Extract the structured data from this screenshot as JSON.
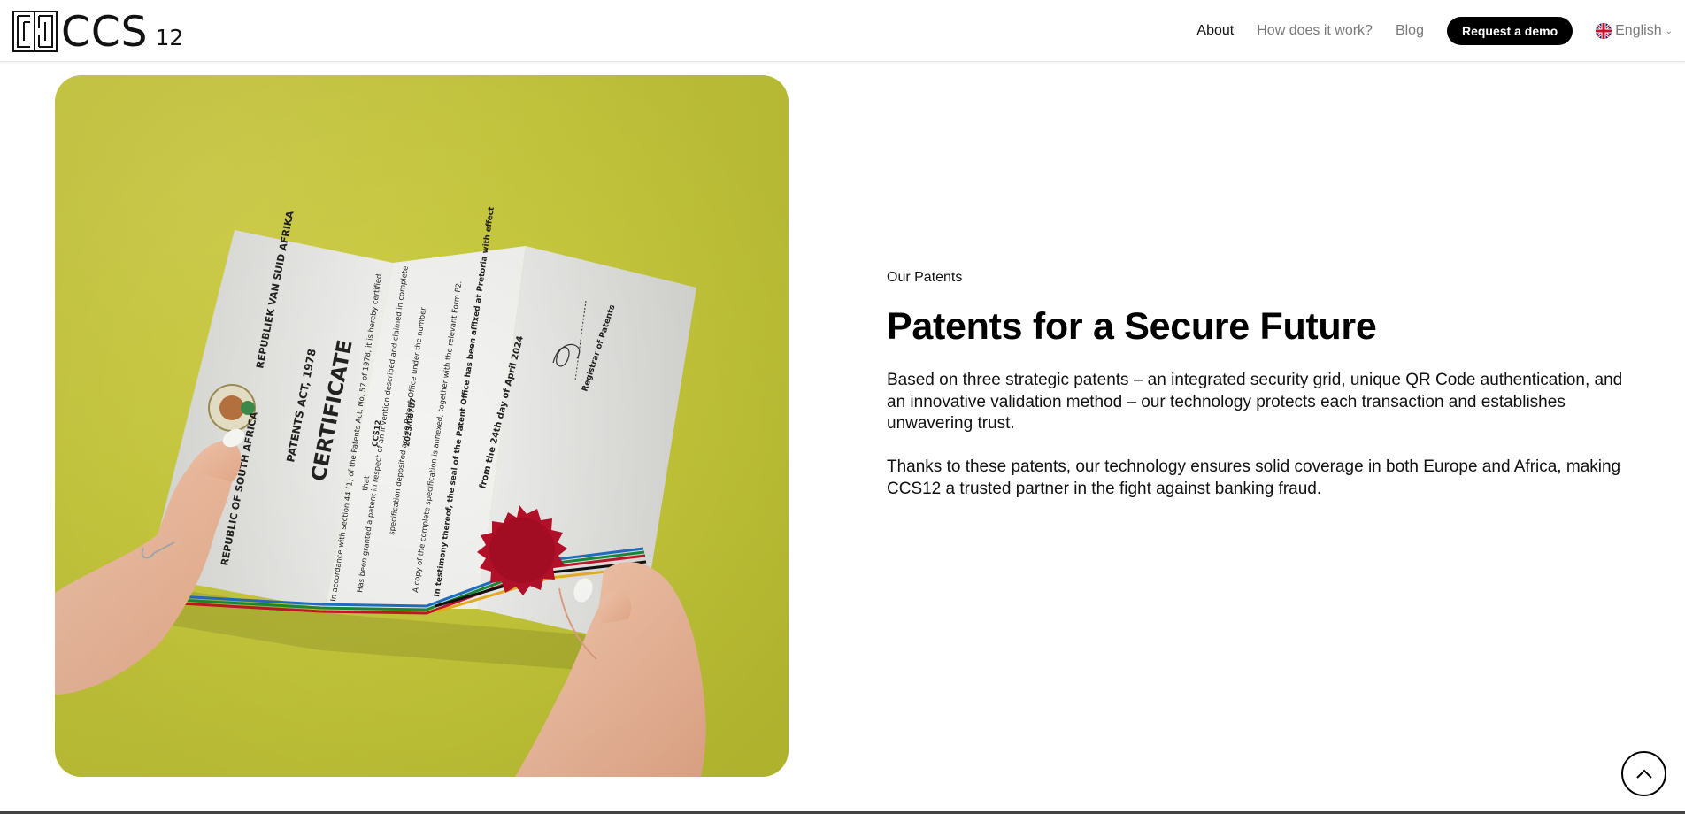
{
  "header": {
    "logo_text": "CCS",
    "logo_sub": "12",
    "nav": [
      {
        "label": "About",
        "active": true
      },
      {
        "label": "How does it work?",
        "active": false
      },
      {
        "label": "Blog",
        "active": false
      }
    ],
    "cta_label": "Request a demo",
    "language": "English"
  },
  "photo": {
    "certificate": {
      "republic_top": "REPUBLIEK VAN SUID AFRIKA",
      "act": "PATENTS ACT, 1978",
      "heading": "CERTIFICATE",
      "republic_bottom": "REPUBLIC OF SOUTH AFRICA",
      "body_lines": [
        "In accordance with section 44 (1) of the Patents Act, No. 57 of 1978, it is hereby certified",
        "that",
        "CCS12",
        "Has been granted a patent in respect of an invention described and claimed in complete",
        "specification deposited at the Patent Office under the number",
        "2023/08787",
        "A copy of the complete specification is annexed, together with the relevant Form P2.",
        "In testimony thereof, the seal of the Patent Office has been affixed at Pretoria with effect",
        "from the 24th day of April 2024"
      ],
      "registrar": "Registrar of Patents"
    }
  },
  "content": {
    "eyebrow": "Our Patents",
    "title": "Patents for a Secure Future",
    "paragraph1": "Based on three strategic patents – an integrated security grid, unique QR Code authentication, and an innovative validation method – our technology protects each transaction and establishes unwavering trust.",
    "paragraph2": "Thanks to these patents, our technology ensures solid coverage in both Europe and Africa, making CCS12 a trusted partner in the fight against banking fraud."
  },
  "colors": {
    "accent_bg": "#c9cb3e",
    "seal": "#b5102a",
    "button_bg": "#000000"
  },
  "icons": {
    "back_to_top": "chevron-up-icon",
    "language_flag": "uk-flag-icon",
    "language_chevron": "chevron-down-icon"
  }
}
